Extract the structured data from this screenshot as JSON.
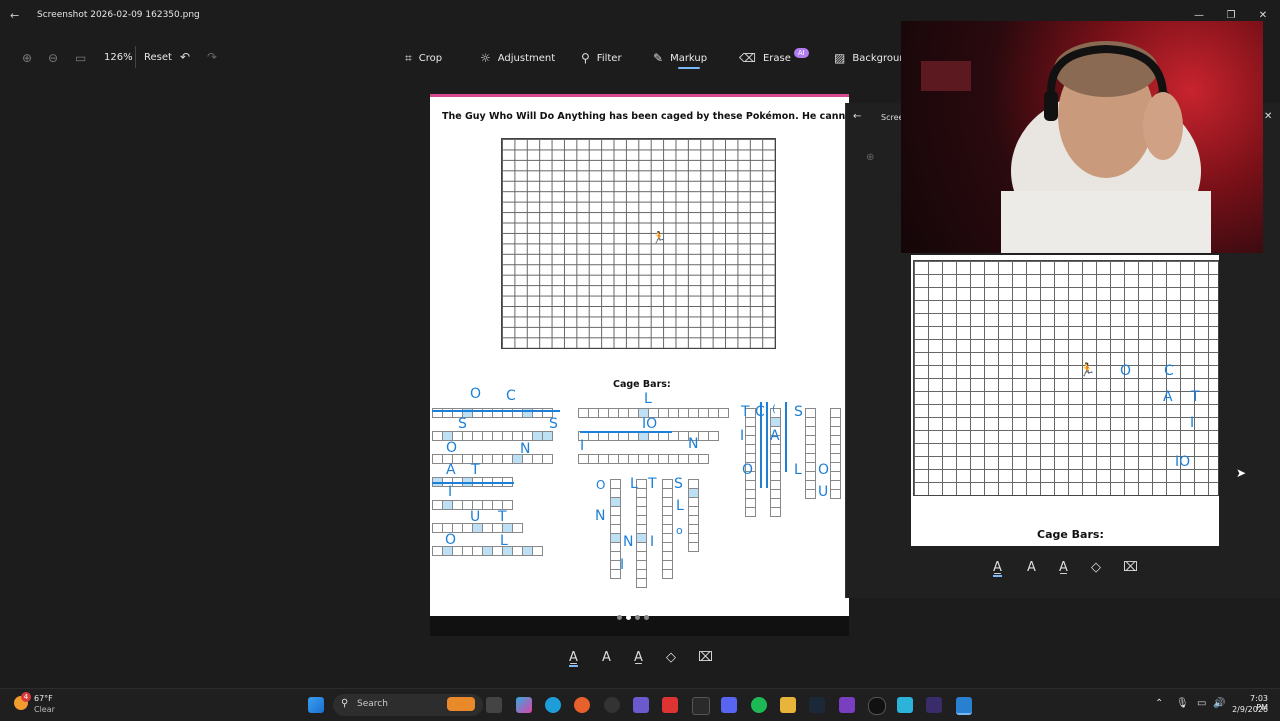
{
  "window": {
    "title": "Screenshot 2026-02-09 162350.png"
  },
  "toolbar": {
    "zoom": "126%",
    "reset": "Reset",
    "tools": [
      "Crop",
      "Adjustment",
      "Filter",
      "Markup",
      "Erase",
      "Backgroun"
    ],
    "erase_badge": "AI"
  },
  "document": {
    "heading": "The Guy Who Will Do Anything has been caged by these Pokémon. He cannot get out.",
    "cage_label": "Cage Bars:"
  },
  "panel": {
    "title": "Scree",
    "cage_label": "Cage Bars:"
  },
  "taskbar": {
    "weather_temp": "67°F",
    "weather_desc": "Clear",
    "weather_badge": "4",
    "search_placeholder": "Search",
    "time": "7:03 PM",
    "date": "2/9/2026"
  },
  "icons": {
    "back": "back-arrow-icon",
    "crop": "crop-icon",
    "adjustment": "adjustment-icon",
    "filter": "filter-icon",
    "markup": "pen-icon",
    "erase": "erase-icon",
    "background": "background-icon"
  },
  "colors": {
    "accent": "#d9488c",
    "handwriting": "#1d7fd6",
    "cells": "#bde0f4",
    "ai_badge": "#b07cf0"
  }
}
